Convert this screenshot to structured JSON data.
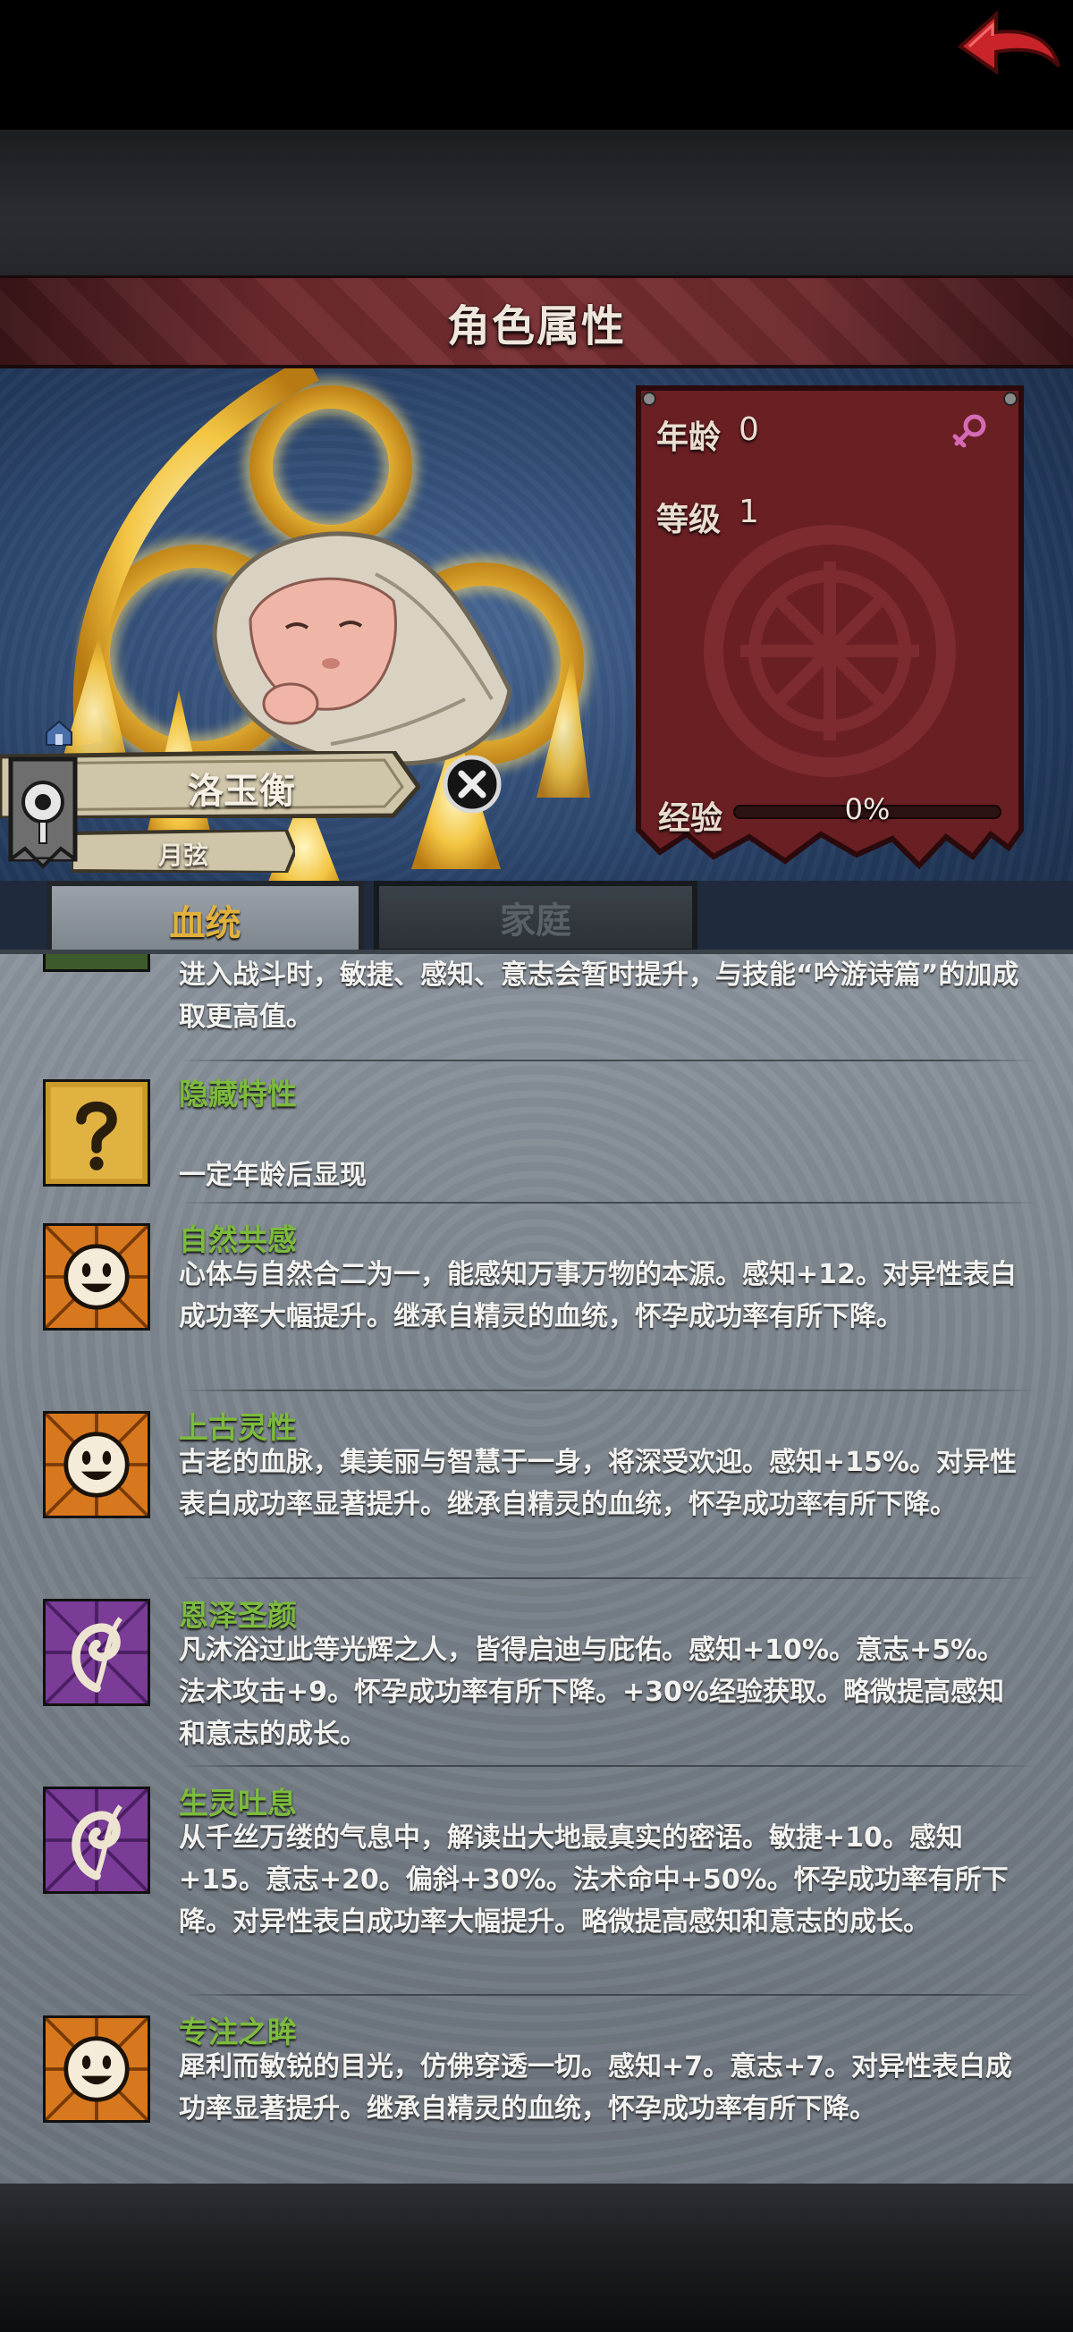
{
  "header": {
    "title": "角色属性",
    "back_icon": "red-back-arrow-icon"
  },
  "character": {
    "name": "洛玉衡",
    "lineage": "月弦",
    "stats": {
      "age_label": "年龄",
      "age_value": "0",
      "level_label": "等级",
      "level_value": "1",
      "exp_label": "经验",
      "exp_value": "0%",
      "exp_fraction": 0
    },
    "gender_icon": "female-symbol-icon"
  },
  "tabs": [
    {
      "label": "血统",
      "active": true
    },
    {
      "label": "家庭",
      "active": false
    }
  ],
  "traits": [
    {
      "name": "",
      "icon": "tree-icon",
      "desc": "进入战斗时，敏捷、感知、意志会暂时提升，与技能“吟游诗篇”的加成取更高值。"
    },
    {
      "name": "隐藏特性",
      "icon": "question-mark-icon",
      "desc": "一定年龄后显现"
    },
    {
      "name": "自然共感",
      "icon": "smiley-face-icon",
      "desc": "心体与自然合二为一，能感知万事万物的本源。感知+12。对异性表白成功率大幅提升。继承自精灵的血统，怀孕成功率有所下降。"
    },
    {
      "name": "上古灵性",
      "icon": "smiley-face-icon",
      "desc": "古老的血脉，集美丽与智慧于一身，将深受欢迎。感知+15%。对异性表白成功率显著提升。继承自精灵的血统，怀孕成功率有所下降。"
    },
    {
      "name": "恩泽圣颜",
      "icon": "spiral-swirl-icon",
      "desc": "凡沐浴过此等光辉之人，皆得启迪与庇佑。感知+10%。意志+5%。法术攻击+9。怀孕成功率有所下降。+30%经验获取。略微提高感知和意志的成长。"
    },
    {
      "name": "生灵吐息",
      "icon": "spiral-swirl-icon",
      "desc": "从千丝万缕的气息中，解读出大地最真实的密语。敏捷+10。感知+15。意志+20。偏斜+30%。法术命中+50%。怀孕成功率有所下降。对异性表白成功率大幅提升。略微提高感知和意志的成长。"
    },
    {
      "name": "专注之眸",
      "icon": "smiley-face-icon",
      "desc": "犀利而敏锐的目光，仿佛穿透一切。感知+7。意志+7。对异性表白成功率显著提升。继承自精灵的血统，怀孕成功率有所下降。"
    }
  ]
}
